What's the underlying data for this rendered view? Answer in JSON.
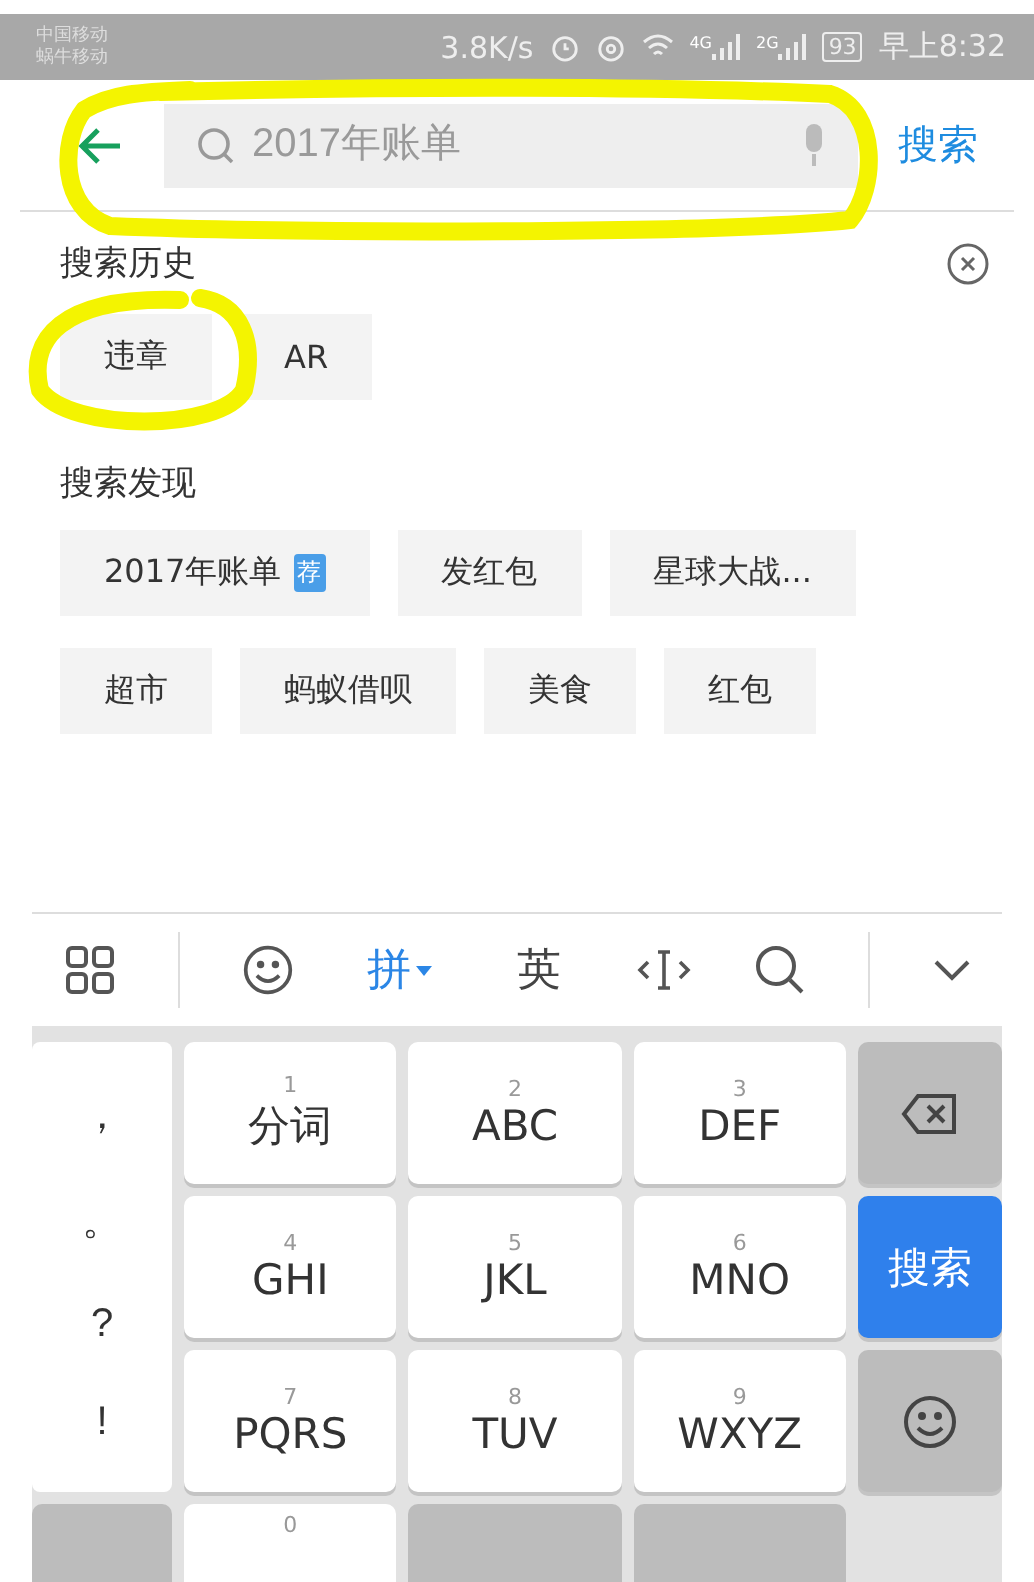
{
  "status_bar": {
    "carriers": [
      "中国移动",
      "蜗牛移动"
    ],
    "speed": "3.8K/s",
    "signals": [
      "4G",
      "2G"
    ],
    "battery": "93",
    "time": "早上8:32"
  },
  "search_bar": {
    "placeholder": "2017年账单",
    "button": "搜索"
  },
  "history": {
    "title": "搜索历史",
    "items": [
      "违章",
      "AR"
    ]
  },
  "discover": {
    "title": "搜索发现",
    "items": [
      {
        "label": "2017年账单",
        "badge": "荐"
      },
      {
        "label": "发红包"
      },
      {
        "label": "星球大战..."
      },
      {
        "label": "超市"
      },
      {
        "label": "蚂蚁借呗"
      },
      {
        "label": "美食"
      },
      {
        "label": "红包"
      }
    ]
  },
  "keyboard": {
    "modes": [
      {
        "label": "拼",
        "selected": true
      },
      {
        "label": "英",
        "selected": false
      }
    ],
    "symbols": [
      "，",
      "。",
      "?",
      "!"
    ],
    "keys": [
      {
        "number": "1",
        "label": "分词"
      },
      {
        "number": "2",
        "label": "ABC"
      },
      {
        "number": "3",
        "label": "DEF"
      },
      {
        "number": "4",
        "label": "GHI"
      },
      {
        "number": "5",
        "label": "JKL"
      },
      {
        "number": "6",
        "label": "MNO"
      },
      {
        "number": "7",
        "label": "PQRS"
      },
      {
        "number": "8",
        "label": "TUV"
      },
      {
        "number": "9",
        "label": "WXYZ"
      }
    ],
    "side": [
      {
        "kind": "delete"
      },
      {
        "kind": "search",
        "label": "搜索"
      },
      {
        "kind": "emoji"
      }
    ],
    "bottom_row": [
      {
        "kind": "dark"
      },
      {
        "kind": "light",
        "number": "0"
      },
      {
        "kind": "dark"
      },
      {
        "kind": "dark"
      }
    ]
  }
}
